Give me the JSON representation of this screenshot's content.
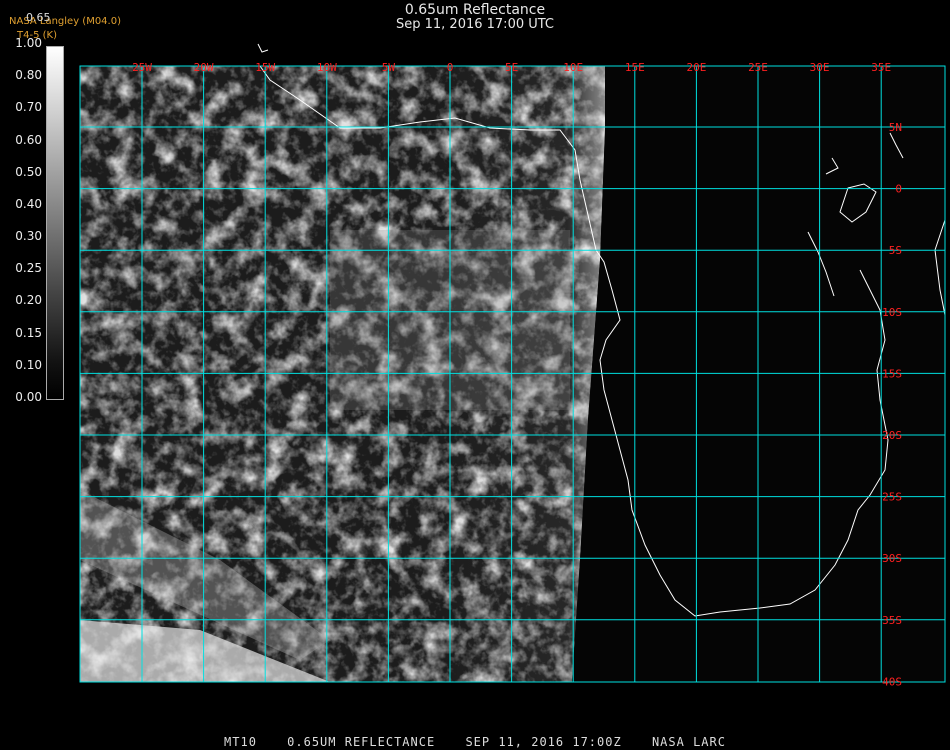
{
  "header": {
    "title": "0.65um Reflectance",
    "subtitle": "Sep 11, 2016 17:00 UTC",
    "credit_line1": "NASA Langley (M04.0)",
    "credit_line2": "T4-5 (K)",
    "colorbar_value": "0.65"
  },
  "colorbar": {
    "ticks": [
      "1.00",
      "0.80",
      "0.70",
      "0.60",
      "0.50",
      "0.40",
      "0.30",
      "0.25",
      "0.20",
      "0.15",
      "0.10",
      "0.00"
    ]
  },
  "map": {
    "lon_labels": [
      "25W",
      "20W",
      "15W",
      "10W",
      "5W",
      "0",
      "5E",
      "10E",
      "15E",
      "20E",
      "25E",
      "30E",
      "35E"
    ],
    "lat_labels": [
      "5N",
      "0",
      "5S",
      "10S",
      "15S",
      "20S",
      "25S",
      "30S",
      "35S",
      "40S"
    ],
    "grid_color": "#00e0e0",
    "label_color": "#ff2020"
  },
  "footer": {
    "product": "MT10",
    "description": "0.65UM REFLECTANCE",
    "datetime": "SEP 11, 2016 17:00Z",
    "source": "NASA LARC"
  }
}
